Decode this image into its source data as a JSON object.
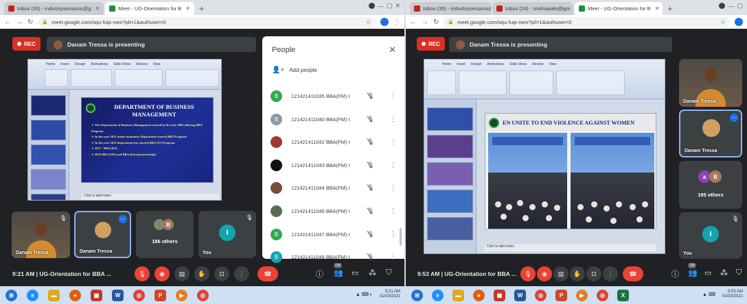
{
  "left": {
    "tabs": [
      {
        "label": "Inbox (35) - industrysessions@g",
        "favicon_color": "#c5221f",
        "active": false
      },
      {
        "label": "Meet - UG-Orientation for B",
        "favicon_color": "#1e8e3e",
        "active": true
      }
    ],
    "url": "meet.google.com/oqu-fuip-rwm?pli=1&authuser=0",
    "rec_label": "REC",
    "presenting_label": "Danam Tressa is presenting",
    "slide": {
      "title": "DEPARTMENT OF BUSINESS MANAGEMENT",
      "bullets": [
        "The Department of Business Management started in the year 2001 offering BBA Program",
        "In the year 2012 under autonomy Department started BBA Program",
        "In the year 2015 department has started BBA (IT) Program",
        "2017 - BBA (BA)",
        "2019 BBA (FM) and BBA (Entrepreneurship)"
      ],
      "notes_placeholder": "Click to add notes"
    },
    "people_panel": {
      "title": "People",
      "add_people": "Add people",
      "participants": [
        {
          "name": "121421411035 BBA(FM) I",
          "initial": "B",
          "color": "#34a853"
        },
        {
          "name": "121421411040 BBA(FM) I",
          "initial": "B",
          "color": "#8d9ba6"
        },
        {
          "name": "121421411042 BBA(FM) I",
          "initial": "",
          "color": "#9c3a2b"
        },
        {
          "name": "121421411043 BBA(FM) I",
          "initial": "",
          "color": "#111111"
        },
        {
          "name": "121421411044 BBA(FM) I",
          "initial": "",
          "color": "#7a4a3a"
        },
        {
          "name": "121421411046 BBA(FM) I",
          "initial": "",
          "color": "#5a6b55"
        },
        {
          "name": "121421411047 BBA(FM) I",
          "initial": "B",
          "color": "#34a853"
        },
        {
          "name": "121421411048 BBA(FM) I",
          "initial": "B",
          "color": "#12a4af"
        }
      ]
    },
    "tiles": {
      "tile1_label": "Danam Tressa",
      "tile2_label": "Danam Tressa",
      "others_label": "186 others",
      "others_initial": "B",
      "you_label": "You",
      "you_initial": "I"
    },
    "meeting_info": "9:21 AM  |  UG-Orientation for BBA ...",
    "chat_count": "190"
  },
  "right": {
    "tabs": [
      {
        "label": "Inbox (35) - industrysessions@",
        "favicon_color": "#c5221f",
        "active": false
      },
      {
        "label": "Inbox (24) - smilnayate@gm",
        "favicon_color": "#c5221f",
        "active": false
      },
      {
        "label": "Meet - UG-Orientation for B",
        "favicon_color": "#1e8e3e",
        "active": true
      }
    ],
    "url": "meet.google.com/oqu-fuip-rwm?pli=1&authuser=0",
    "rec_label": "REC",
    "presenting_label": "Danam Tressa is presenting",
    "slide": {
      "banner": "EN UNITE TO END VIOLENCE AGAINST WOMEN",
      "notes_placeholder": "Click to add notes"
    },
    "tiles": {
      "tile1_label": "Danam Tressa",
      "tile2_label": "Danam Tressa",
      "others_label": "195 others",
      "others_initial_a": "a",
      "others_initial_b": "B",
      "you_label": "You",
      "you_initial": "I"
    },
    "meeting_info": "9:53 AM  |  UG-Orientation for BBA ...",
    "chat_count": "195"
  },
  "taskbar": {
    "left_time": "9:21 AM",
    "left_date": "01/03/2021",
    "right_time": "9:53 AM",
    "right_date": "01/03/2021"
  }
}
